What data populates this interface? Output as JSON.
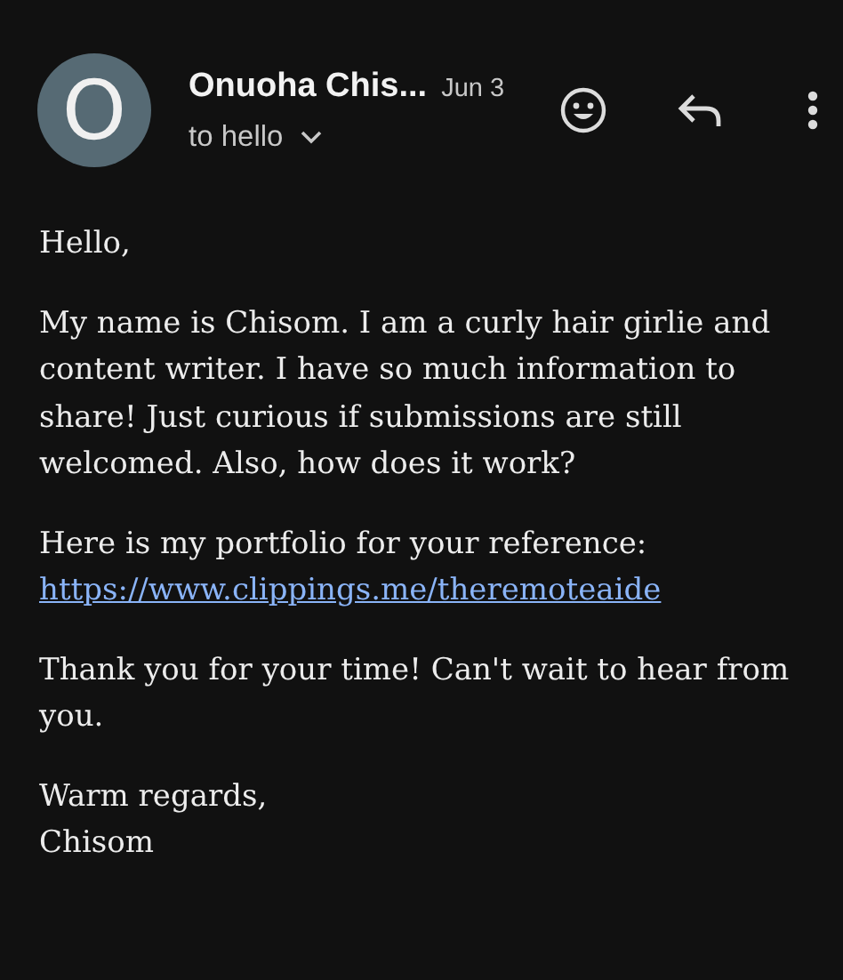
{
  "header": {
    "avatar_letter": "O",
    "sender": "Onuoha Chis...",
    "date": "Jun 3",
    "recipient": "to hello"
  },
  "body": {
    "paragraphs": [
      {
        "text": "Hello,"
      },
      {
        "text": "My name is Chisom. I am a curly hair girlie and content writer. I have so much information to share! Just curious if submissions are still welcomed. Also, how does it work?"
      },
      {
        "text": "Here is my portfolio for your reference:",
        "link": "https://www.clippings.me/theremoteaide"
      },
      {
        "text": "Thank you for your time! Can't wait to hear from you."
      },
      {
        "text": "Warm regards,",
        "line2": "Chisom"
      }
    ]
  }
}
